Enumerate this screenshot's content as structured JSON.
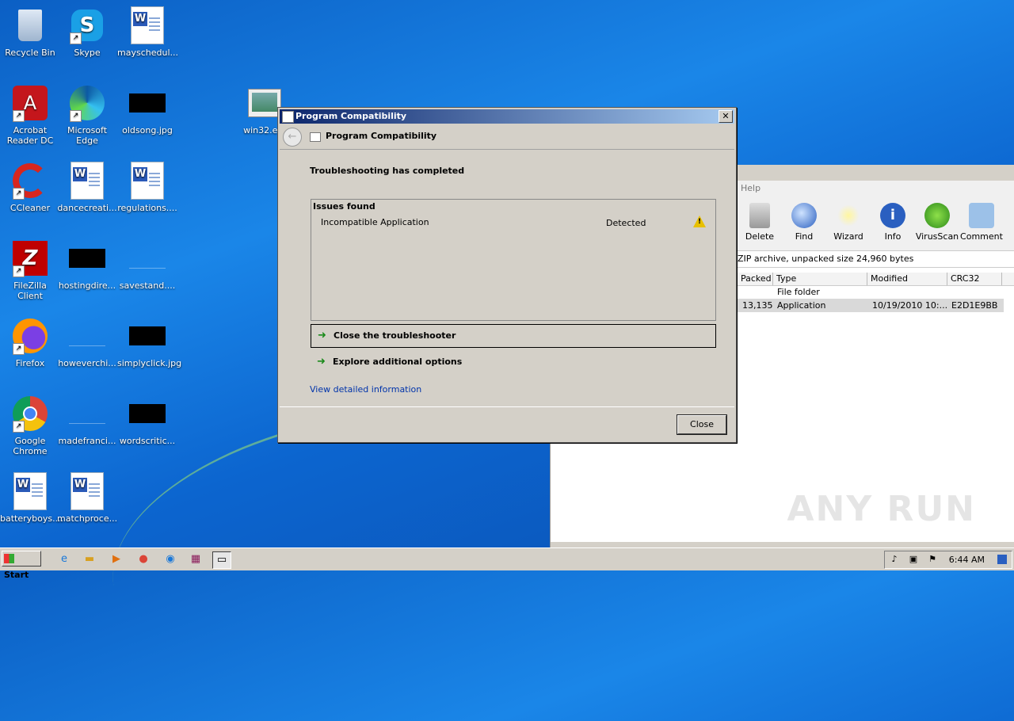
{
  "desktop": {
    "icons": [
      {
        "label": "Recycle Bin",
        "icon": "recycle-bin-icon"
      },
      {
        "label": "Skype",
        "icon": "skype-icon"
      },
      {
        "label": "mayschedul...",
        "icon": "word-document-icon"
      },
      {
        "label": "Acrobat Reader DC",
        "icon": "acrobat-icon"
      },
      {
        "label": "Microsoft Edge",
        "icon": "edge-icon"
      },
      {
        "label": "oldsong.jpg",
        "icon": "image-file-icon"
      },
      {
        "label": "win32.e...",
        "icon": "executable-icon"
      },
      {
        "label": "CCleaner",
        "icon": "ccleaner-icon"
      },
      {
        "label": "dancecreati...",
        "icon": "word-document-icon"
      },
      {
        "label": "regulations....",
        "icon": "word-document-icon"
      },
      {
        "label": "FileZilla Client",
        "icon": "filezilla-icon"
      },
      {
        "label": "hostingdire...",
        "icon": "image-file-icon"
      },
      {
        "label": "savestand....",
        "icon": "file-icon"
      },
      {
        "label": "Firefox",
        "icon": "firefox-icon"
      },
      {
        "label": "howeverchi...",
        "icon": "file-icon"
      },
      {
        "label": "simplyclick.jpg",
        "icon": "image-file-icon"
      },
      {
        "label": "Google Chrome",
        "icon": "chrome-icon"
      },
      {
        "label": "madefranci...",
        "icon": "file-icon"
      },
      {
        "label": "wordscritic...",
        "icon": "image-file-icon"
      },
      {
        "label": "batteryboys....",
        "icon": "word-document-icon"
      },
      {
        "label": "matchproce...",
        "icon": "word-document-icon"
      }
    ]
  },
  "archive_window": {
    "menu_help": "Help",
    "toolbar": [
      "Delete",
      "Find",
      "Wizard",
      "Info",
      "VirusScan",
      "Comment"
    ],
    "path_text": "ZIP archive, unpacked size 24,960 bytes",
    "columns": [
      "Packed",
      "Type",
      "Modified",
      "CRC32"
    ],
    "rows": [
      {
        "packed": "",
        "type": "File folder",
        "modified": "",
        "crc": ""
      },
      {
        "packed": "13,135",
        "type": "Application",
        "modified": "10/19/2010 10:...",
        "crc": "E2D1E9BB"
      }
    ],
    "watermark": "ANY RUN"
  },
  "dialog": {
    "window_title": "Program Compatibility",
    "nav_title": "Program Compatibility",
    "heading": "Troubleshooting has completed",
    "issues_header": "Issues found",
    "issue_name": "Incompatible Application",
    "issue_status": "Detected",
    "option_close": "Close the troubleshooter",
    "option_explore": "Explore additional options",
    "detail_link": "View detailed information",
    "close_button": "Close"
  },
  "taskbar": {
    "start_label": "Start",
    "clock": "6:44 AM"
  }
}
